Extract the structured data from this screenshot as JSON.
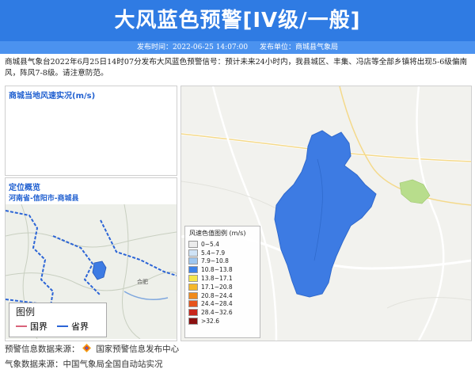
{
  "banner": {
    "title": "大风蓝色预警[IV级/一般]"
  },
  "meta": {
    "publish_time": "发布时间：2022-06-25 14:07:00",
    "publisher": "发布单位：商城县气象局"
  },
  "description": "商城县气象台2022年6月25日14时07分发布大风蓝色预警信号：预计未来24小时内，我县城区、丰集、冯店等全部乡镇将出现5-6级偏南风，阵风7-8级。请注意防范。",
  "wind_panel": {
    "title": "商城当地风速实况(m/s)"
  },
  "location_panel": {
    "title": "定位概览",
    "path": "河南省-信阳市-商城县",
    "map_labels": {
      "hefei": "合肥"
    },
    "legend": {
      "title": "图例",
      "national": "国界",
      "provincial": "省界"
    },
    "colors": {
      "national": "#d9627a",
      "provincial": "#2b64d6"
    }
  },
  "map": {
    "legend_title": "风速色值图例 (m/s)",
    "legend_items": [
      {
        "label": "0~5.4",
        "color": "#ececec"
      },
      {
        "label": "5.4~7.9",
        "color": "#cfe3f6"
      },
      {
        "label": "7.9~10.8",
        "color": "#9fc7f0"
      },
      {
        "label": "10.8~13.8",
        "color": "#3d82e8"
      },
      {
        "label": "13.8~17.1",
        "color": "#f5e64a"
      },
      {
        "label": "17.1~20.8",
        "color": "#f5b72a"
      },
      {
        "label": "20.8~24.4",
        "color": "#f08a1c"
      },
      {
        "label": "24.4~28.4",
        "color": "#e6541c"
      },
      {
        "label": "28.4~32.6",
        "color": "#c8261c"
      },
      {
        "label": ">32.6",
        "color": "#8a1010"
      }
    ],
    "region_color": "#3d7be3"
  },
  "footer": {
    "warning_source_label": "预警信息数据来源：",
    "warning_source": "国家预警信息发布中心",
    "weather_source": "气象数据来源：中国气象局全国自动站实况"
  }
}
